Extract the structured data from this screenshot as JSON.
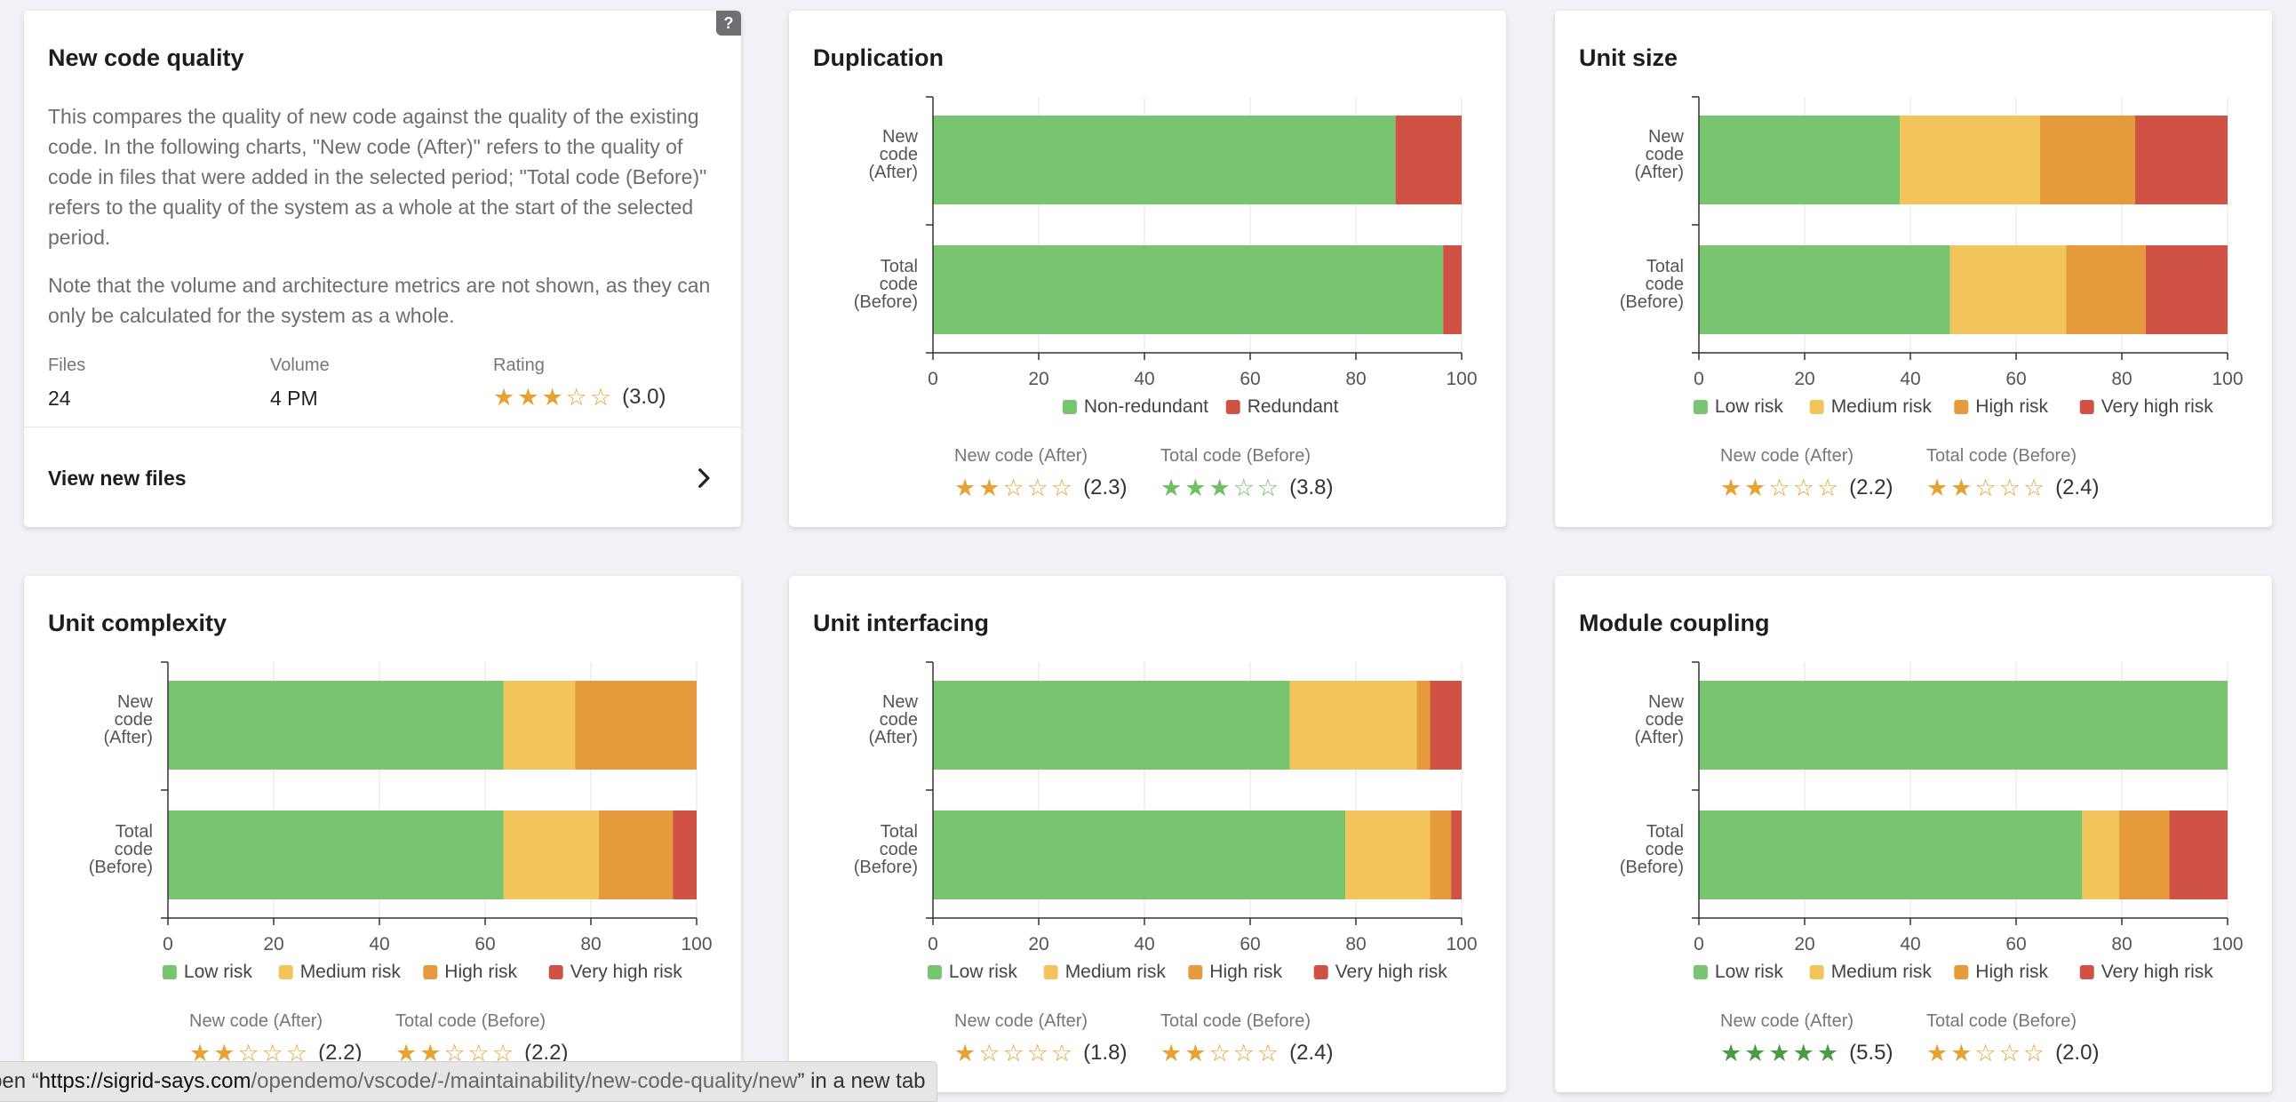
{
  "intro_card": {
    "title": "New code quality",
    "help_label": "?",
    "paragraph1": "This compares the quality of new code against the quality of the existing code. In the following charts, \"New code (After)\" refers to the quality of code in files that were added in the selected period; \"Total code (Before)\" refers to the quality of the system as a whole at the start of the selected period.",
    "paragraph2": "Note that the volume and architecture metrics are not shown, as they can only be calculated for the system as a whole.",
    "stats": {
      "files_label": "Files",
      "files_value": "24",
      "volume_label": "Volume",
      "volume_value": "4 PM",
      "rating_label": "Rating",
      "rating_text": "(3.0)",
      "rating_value": 3.0
    },
    "view_new_files": "View new files",
    "chevron_icon": "chevron-right-icon"
  },
  "colors": {
    "low": "#78c46f",
    "medium": "#f1c55b",
    "high": "#e59b3b",
    "very_high": "#d05245",
    "star_orange": "#e6a233",
    "star_green": "#6fbf63",
    "star_dark_green": "#4a9c44"
  },
  "rating_labels": {
    "new": "New code (After)",
    "total": "Total code (Before)"
  },
  "chart_data": [
    {
      "type": "bar",
      "orientation": "horizontal",
      "stacked": true,
      "title": "Duplication",
      "categories": [
        [
          "New",
          "code",
          "(After)"
        ],
        [
          "Total",
          "code",
          "(Before)"
        ]
      ],
      "series": [
        {
          "name": "Non-redundant",
          "color": "#78c46f",
          "values": [
            87.5,
            96.5
          ]
        },
        {
          "name": "Redundant",
          "color": "#d05245",
          "values": [
            12.5,
            3.5
          ]
        }
      ],
      "xlim": [
        0,
        100
      ],
      "xticks": [
        0,
        20,
        40,
        60,
        80,
        100
      ],
      "legend": "bottom",
      "ratings": {
        "new": {
          "value": 2.3,
          "text": "(2.3)",
          "color": "#e6a233"
        },
        "total": {
          "value": 3.8,
          "text": "(3.8)",
          "color": "#6fbf63"
        }
      }
    },
    {
      "type": "bar",
      "orientation": "horizontal",
      "stacked": true,
      "title": "Unit size",
      "categories": [
        [
          "New",
          "code",
          "(After)"
        ],
        [
          "Total",
          "code",
          "(Before)"
        ]
      ],
      "series": [
        {
          "name": "Low risk",
          "color": "#78c46f",
          "values": [
            38,
            47.5
          ]
        },
        {
          "name": "Medium risk",
          "color": "#f1c55b",
          "values": [
            26.5,
            22
          ]
        },
        {
          "name": "High risk",
          "color": "#e59b3b",
          "values": [
            18,
            15
          ]
        },
        {
          "name": "Very high risk",
          "color": "#d05245",
          "values": [
            17.5,
            15.5
          ]
        }
      ],
      "xlim": [
        0,
        100
      ],
      "xticks": [
        0,
        20,
        40,
        60,
        80,
        100
      ],
      "legend": "bottom",
      "ratings": {
        "new": {
          "value": 2.2,
          "text": "(2.2)",
          "color": "#e6a233"
        },
        "total": {
          "value": 2.4,
          "text": "(2.4)",
          "color": "#e6a233"
        }
      }
    },
    {
      "type": "bar",
      "orientation": "horizontal",
      "stacked": true,
      "title": "Unit complexity",
      "categories": [
        [
          "New",
          "code",
          "(After)"
        ],
        [
          "Total",
          "code",
          "(Before)"
        ]
      ],
      "series": [
        {
          "name": "Low risk",
          "color": "#78c46f",
          "values": [
            63.5,
            63.5
          ]
        },
        {
          "name": "Medium risk",
          "color": "#f1c55b",
          "values": [
            13.5,
            18
          ]
        },
        {
          "name": "High risk",
          "color": "#e59b3b",
          "values": [
            23,
            14
          ]
        },
        {
          "name": "Very high risk",
          "color": "#d05245",
          "values": [
            0,
            4.5
          ]
        }
      ],
      "xlim": [
        0,
        100
      ],
      "xticks": [
        0,
        20,
        40,
        60,
        80,
        100
      ],
      "legend": "bottom",
      "ratings": {
        "new": {
          "value": 2.2,
          "text": "(2.2)",
          "color": "#e6a233"
        },
        "total": {
          "value": 2.2,
          "text": "(2.2)",
          "color": "#e6a233"
        }
      }
    },
    {
      "type": "bar",
      "orientation": "horizontal",
      "stacked": true,
      "title": "Unit interfacing",
      "categories": [
        [
          "New",
          "code",
          "(After)"
        ],
        [
          "Total",
          "code",
          "(Before)"
        ]
      ],
      "series": [
        {
          "name": "Low risk",
          "color": "#78c46f",
          "values": [
            67.5,
            78
          ]
        },
        {
          "name": "Medium risk",
          "color": "#f1c55b",
          "values": [
            24,
            16
          ]
        },
        {
          "name": "High risk",
          "color": "#e59b3b",
          "values": [
            2.5,
            4
          ]
        },
        {
          "name": "Very high risk",
          "color": "#d05245",
          "values": [
            6,
            2
          ]
        }
      ],
      "xlim": [
        0,
        100
      ],
      "xticks": [
        0,
        20,
        40,
        60,
        80,
        100
      ],
      "legend": "bottom",
      "ratings": {
        "new": {
          "value": 1.8,
          "text": "(1.8)",
          "color": "#e6a233"
        },
        "total": {
          "value": 2.4,
          "text": "(2.4)",
          "color": "#e6a233"
        }
      }
    },
    {
      "type": "bar",
      "orientation": "horizontal",
      "stacked": true,
      "title": "Module coupling",
      "categories": [
        [
          "New",
          "code",
          "(After)"
        ],
        [
          "Total",
          "code",
          "(Before)"
        ]
      ],
      "series": [
        {
          "name": "Low risk",
          "color": "#78c46f",
          "values": [
            100,
            72.5
          ]
        },
        {
          "name": "Medium risk",
          "color": "#f1c55b",
          "values": [
            0,
            7
          ]
        },
        {
          "name": "High risk",
          "color": "#e59b3b",
          "values": [
            0,
            9.5
          ]
        },
        {
          "name": "Very high risk",
          "color": "#d05245",
          "values": [
            0,
            11
          ]
        }
      ],
      "xlim": [
        0,
        100
      ],
      "xticks": [
        0,
        20,
        40,
        60,
        80,
        100
      ],
      "legend": "bottom",
      "ratings": {
        "new": {
          "value": 5.5,
          "text": "(5.5)",
          "color": "#4a9c44"
        },
        "total": {
          "value": 2.0,
          "text": "(2.0)",
          "color": "#e6a233"
        }
      }
    }
  ],
  "status_bar": {
    "prefix": "pen “",
    "host": "https://sigrid-says.com",
    "path": "/opendemo/vscode/-/maintainability/new-code-quality/new",
    "suffix": "” in a new tab"
  }
}
